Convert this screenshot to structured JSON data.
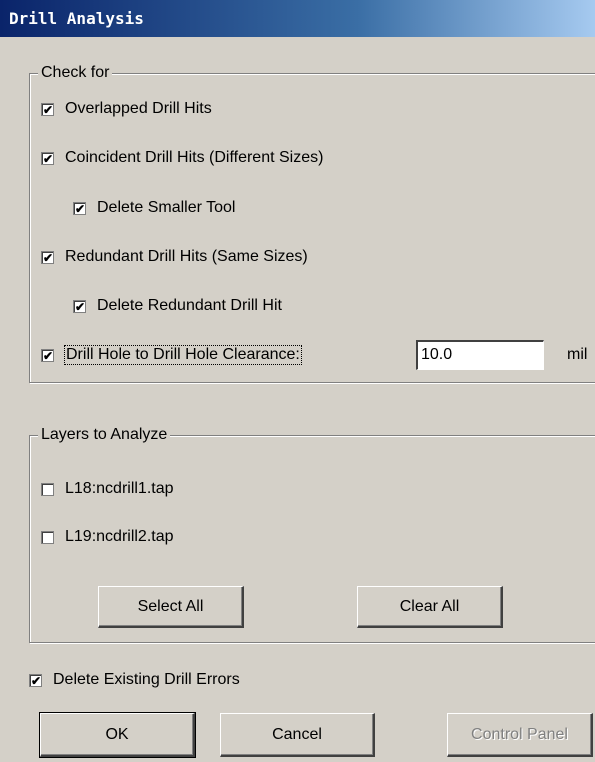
{
  "window": {
    "title": "Drill Analysis"
  },
  "check_for": {
    "label": "Check for",
    "items": [
      {
        "label": "Overlapped Drill Hits",
        "checked": true
      },
      {
        "label": "Coincident Drill Hits (Different Sizes)",
        "checked": true
      },
      {
        "label": "Delete Smaller Tool",
        "checked": true
      },
      {
        "label": "Redundant Drill Hits (Same Sizes)",
        "checked": true
      },
      {
        "label": "Delete Redundant Drill Hit",
        "checked": true
      },
      {
        "label": "Drill Hole to Drill Hole Clearance:",
        "checked": true
      }
    ],
    "clearance_value": "10.0",
    "clearance_unit": "mil"
  },
  "layers": {
    "label": "Layers to Analyze",
    "items": [
      {
        "label": "L18:ncdrill1.tap",
        "checked": false
      },
      {
        "label": "L19:ncdrill2.tap",
        "checked": false
      }
    ],
    "select_all_label": "Select All",
    "clear_all_label": "Clear All"
  },
  "delete_existing": {
    "label": "Delete Existing Drill Errors",
    "checked": true
  },
  "buttons": {
    "ok_label": "OK",
    "cancel_label": "Cancel",
    "control_panel_label": "Control Panel"
  },
  "check_glyph": "✔"
}
